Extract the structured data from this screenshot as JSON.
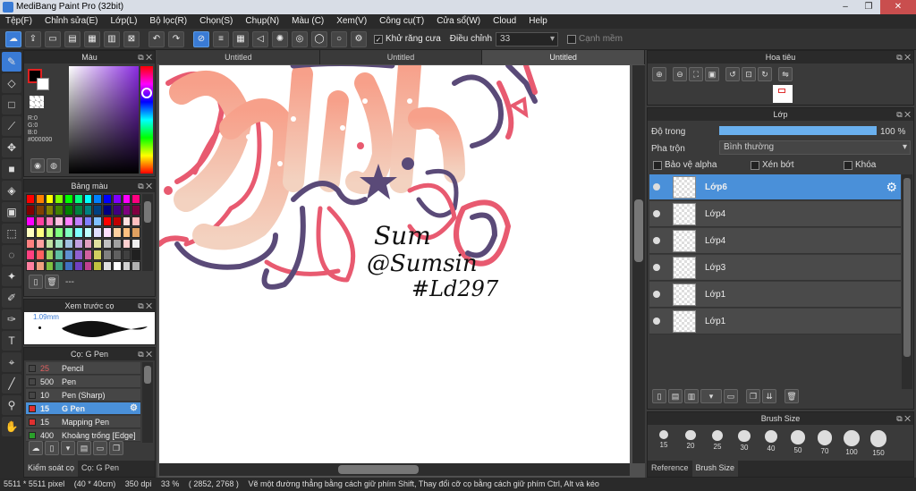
{
  "window": {
    "title": "MediBang Paint Pro (32bit)",
    "controls": [
      "–",
      "❐",
      "✕"
    ]
  },
  "menu": [
    "Tệp(F)",
    "Chỉnh sửa(E)",
    "Lớp(L)",
    "Bộ lọc(R)",
    "Chọn(S)",
    "Chụp(N)",
    "Màu (C)",
    "Xem(V)",
    "Công cụ(T)",
    "Cửa sổ(W)",
    "Cloud",
    "Help"
  ],
  "toolbar": {
    "antialias_label": "Khử răng cưa",
    "correction_label": "Điều chỉnh",
    "correction_value": "33",
    "snap_label": "Cạnh mềm"
  },
  "tabs": [
    "Untitled",
    "Untitled",
    "Untitled"
  ],
  "color_panel": {
    "title": "Màu",
    "r": "R:0",
    "g": "G:0",
    "b": "B:0",
    "hex": "#000000",
    "primary": "#000000",
    "hue": "#8a2be2"
  },
  "palette_panel": {
    "title": "Bảng màu",
    "more": "---"
  },
  "brush_preview": {
    "title": "Xem trước cọ",
    "size": "1.09mm"
  },
  "brush_panel": {
    "title": "Cọ: G Pen",
    "items": [
      {
        "size": "25",
        "name": "Pencil",
        "color": "#3a3a3a"
      },
      {
        "size": "500",
        "name": "Pen",
        "color": "#3a3a3a"
      },
      {
        "size": "10",
        "name": "Pen (Sharp)",
        "color": "#3a3a3a"
      },
      {
        "size": "15",
        "name": "G Pen",
        "color": "#e03030"
      },
      {
        "size": "15",
        "name": "Mapping Pen",
        "color": "#e03030"
      },
      {
        "size": "400",
        "name": "Khoảng trống [Edge]",
        "color": "#2aa02a"
      }
    ],
    "tabs": [
      "Kiểm soát cọ",
      "Cọ: G Pen"
    ]
  },
  "navigator": {
    "title": "Hoa tiêu"
  },
  "layer_panel": {
    "title": "Lớp",
    "opacity_label": "Độ trong",
    "opacity_value": "100 %",
    "opacity": 1.0,
    "blend_label": "Pha trộn",
    "blend_value": "Bình thường",
    "protect_alpha": "Bảo vệ alpha",
    "clipping": "Xén bớt",
    "lock": "Khóa",
    "layers": [
      "Lớp6",
      "Lớp4",
      "Lớp4",
      "Lớp3",
      "Lớp1",
      "Lớp1"
    ]
  },
  "brush_size_panel": {
    "title": "Brush Size",
    "sizes": [
      "15",
      "20",
      "25",
      "30",
      "40",
      "50",
      "70",
      "100",
      "150"
    ],
    "tabs": [
      "Reference",
      "Brush Size"
    ]
  },
  "canvas_text": {
    "line1": "Sum",
    "line2": "@Sumsin",
    "line3": "#Ld297"
  },
  "status": {
    "size": "5511 * 5511 pixel",
    "cm": "(40 * 40cm)",
    "dpi": "350 dpi",
    "zoom": "33 %",
    "coords": "( 2852, 2768 )",
    "hint": "Vẽ một đường thẳng bằng cách giữ phím Shift, Thay đổi cỡ cọ bằng cách giữ phím Ctrl, Alt và kéo"
  }
}
